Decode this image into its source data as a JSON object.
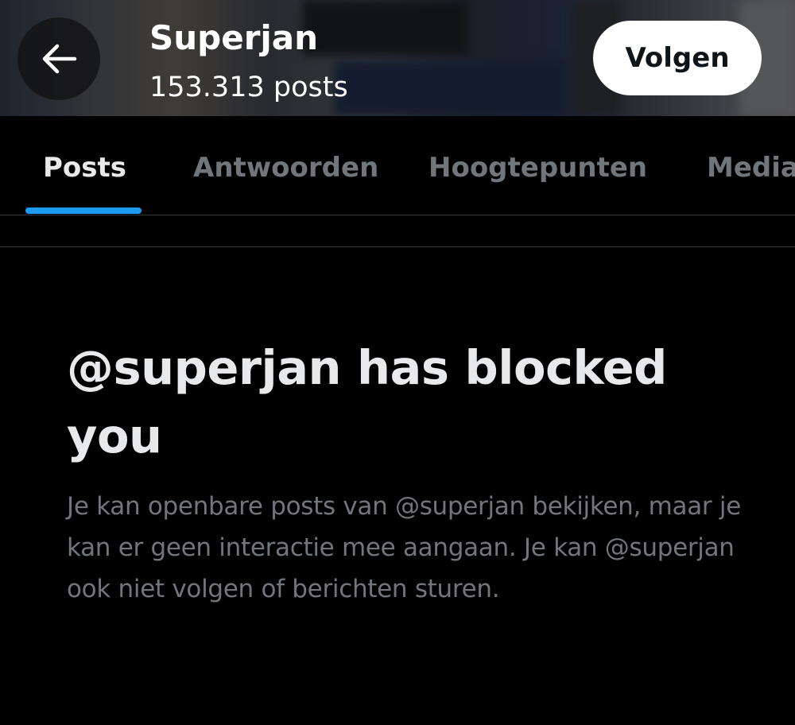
{
  "header": {
    "back_icon": "arrow-left-icon",
    "profile_name": "Superjan",
    "post_count": "153.313 posts",
    "follow_label": "Volgen"
  },
  "tabs": [
    {
      "label": "Posts",
      "active": true
    },
    {
      "label": "Antwoorden",
      "active": false
    },
    {
      "label": "Hoogtepunten",
      "active": false
    },
    {
      "label": "Media",
      "active": false
    }
  ],
  "blocked": {
    "title": "@superjan has blocked you",
    "description": "Je kan openbare posts van @superjan bekijken, maar je kan er geen interactie mee aangaan. Je kan @superjan ook niet volgen of berichten sturen."
  },
  "colors": {
    "background": "#000000",
    "accent": "#1d9bf0",
    "text_primary": "#e7e9ea",
    "text_secondary": "#71767b",
    "divider": "#2f3336"
  }
}
